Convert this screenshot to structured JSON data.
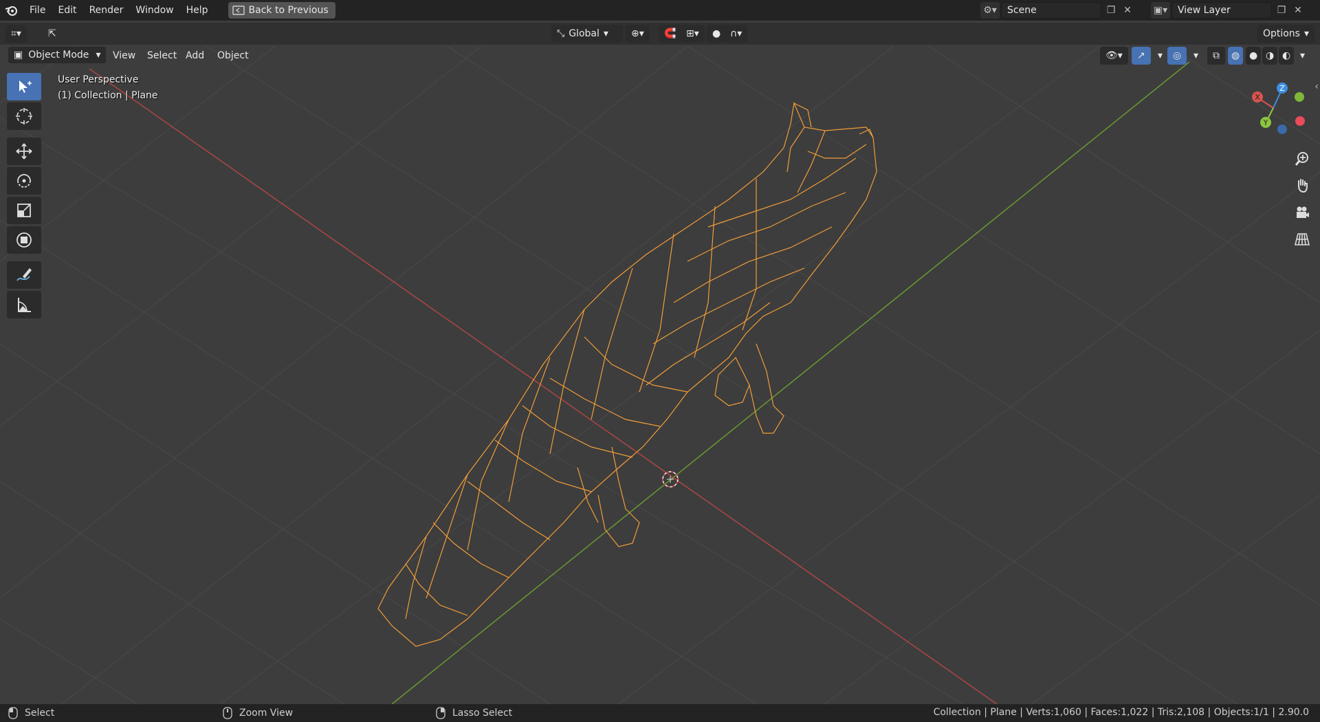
{
  "menubar": {
    "items": [
      "File",
      "Edit",
      "Render",
      "Window",
      "Help"
    ],
    "back_label": "Back to Previous",
    "scene_label": "Scene",
    "view_layer_label": "View Layer"
  },
  "header": {
    "transform_orientation": "Global",
    "options_label": "Options"
  },
  "viewport_header": {
    "mode": "Object Mode",
    "menus": [
      "View",
      "Select",
      "Add",
      "Object"
    ]
  },
  "overlay": {
    "perspective": "User Perspective",
    "collection": "(1) Collection | Plane"
  },
  "gizmo": {
    "x": "X",
    "y": "Y",
    "z": "Z"
  },
  "statusbar": {
    "select": "Select",
    "zoom_view": "Zoom View",
    "lasso_select": "Lasso Select",
    "stats": "Collection | Plane | Verts:1,060 | Faces:1,022 | Tris:2,108 | Objects:1/1 | 2.90.0"
  },
  "colors": {
    "x_axis": "#d9534f",
    "y_axis": "#8cc63f",
    "z_axis": "#3d8fe0",
    "selection": "#f29d38",
    "active_tool": "#4772b3"
  }
}
